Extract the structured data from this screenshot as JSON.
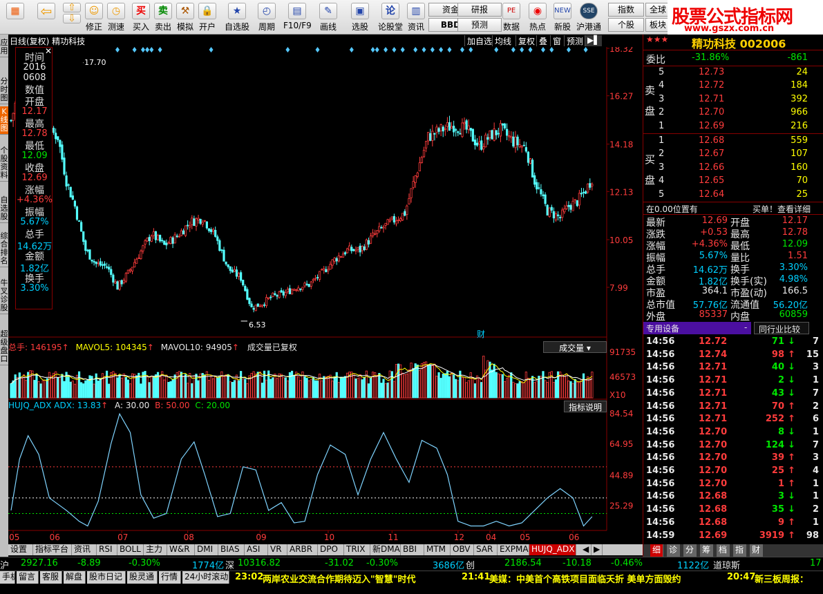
{
  "toolbar": {
    "buttons": [
      "买入",
      "卖出",
      "模拟",
      "开户",
      "自选股",
      "周期",
      "F10/F9",
      "画线",
      "选股",
      "论股堂",
      "资讯",
      "数据",
      "热点",
      "新股",
      "沪港通"
    ],
    "left_buttons": [
      "修正",
      "测速"
    ],
    "small": [
      "资金",
      "BBD",
      "研报",
      "预测",
      "指数",
      "个股",
      "全球",
      "板块"
    ]
  },
  "brand": {
    "title": "股票公式指标网",
    "url": "www.gszx.com.cn"
  },
  "left_tabs": [
    "应用",
    "分时图",
    "K线图",
    "个股资料",
    "自选股",
    "综合排名",
    "牛叉诊股",
    "超级盘口"
  ],
  "chart_header": {
    "title": "日线(复权) 精功科技",
    "controls": [
      "加自选",
      "均线",
      "复权",
      "叠",
      "窗",
      "预测"
    ]
  },
  "info_panel": [
    {
      "label": "时间",
      "value": "2016",
      "color": "white"
    },
    {
      "label": "",
      "value": "0608",
      "color": "white"
    },
    {
      "label": "数值",
      "value": "",
      "color": "white"
    },
    {
      "label": "开盘",
      "value": "12.17",
      "color": "red"
    },
    {
      "label": "最高",
      "value": "12.78",
      "color": "red"
    },
    {
      "label": "最低",
      "value": "12.09",
      "color": "green"
    },
    {
      "label": "收盘",
      "value": "12.69",
      "color": "red"
    },
    {
      "label": "涨幅",
      "value": "+4.36%",
      "color": "red"
    },
    {
      "label": "振幅",
      "value": "5.67%",
      "color": "cyan"
    },
    {
      "label": "总手",
      "value": "14.62万",
      "color": "cyan"
    },
    {
      "label": "金额",
      "value": "1.82亿",
      "color": "cyan"
    },
    {
      "label": "换手",
      "value": "3.30%",
      "color": "cyan"
    }
  ],
  "price_axis": [
    "18.32",
    "16.27",
    "14.18",
    "12.13",
    "10.05",
    "7.99"
  ],
  "price_marks": {
    "high": "17.70",
    "low": "6.53",
    "cai": "财"
  },
  "volume_header": {
    "total": "总手: 146195",
    "ma5": "MAVOL5: 104345",
    "ma10": "MAVOL10: 94905",
    "note": "成交量已复权",
    "selector": "成交量"
  },
  "volume_axis": [
    "91735",
    "46573",
    "X10"
  ],
  "indicator_header": {
    "name": "HUJQ_ADX ADX: 13.83",
    "a": "A: 30.00",
    "b": "B: 50.00",
    "c": "C: 20.00",
    "help": "指标说明"
  },
  "indicator_axis": [
    "84.54",
    "64.95",
    "44.89",
    "25.29"
  ],
  "x_axis": [
    "05",
    "06",
    "07",
    "08",
    "09",
    "10",
    "11",
    "12",
    "04",
    "05",
    "06"
  ],
  "right_panel": {
    "title": "精功科技 002006",
    "weibi_label": "委比",
    "weibi_pct": "-31.86%",
    "weibi_val": "-861",
    "sell_label": "卖盘",
    "buy_label": "买盘",
    "sells": [
      {
        "n": "5",
        "price": "12.73",
        "vol": "24"
      },
      {
        "n": "4",
        "price": "12.72",
        "vol": "184"
      },
      {
        "n": "3",
        "price": "12.71",
        "vol": "392"
      },
      {
        "n": "2",
        "price": "12.70",
        "vol": "966"
      },
      {
        "n": "1",
        "price": "12.69",
        "vol": "216"
      }
    ],
    "buys": [
      {
        "n": "1",
        "price": "12.68",
        "vol": "559"
      },
      {
        "n": "2",
        "price": "12.67",
        "vol": "107"
      },
      {
        "n": "3",
        "price": "12.66",
        "vol": "160"
      },
      {
        "n": "4",
        "price": "12.65",
        "vol": "70"
      },
      {
        "n": "5",
        "price": "12.64",
        "vol": "25"
      }
    ],
    "position_note": "在0.00位置有",
    "position_link": "买单！查看详细",
    "stats": [
      {
        "l1": "最新",
        "v1": "12.69",
        "c1": "red",
        "l2": "开盘",
        "v2": "12.17",
        "c2": "red"
      },
      {
        "l1": "涨跌",
        "v1": "+0.53",
        "c1": "red",
        "l2": "最高",
        "v2": "12.78",
        "c2": "red"
      },
      {
        "l1": "涨幅",
        "v1": "+4.36%",
        "c1": "red",
        "l2": "最低",
        "v2": "12.09",
        "c2": "green"
      },
      {
        "l1": "振幅",
        "v1": "5.67%",
        "c1": "cyan",
        "l2": "量比",
        "v2": "1.51",
        "c2": "red"
      },
      {
        "l1": "总手",
        "v1": "14.62万",
        "c1": "cyan",
        "l2": "换手",
        "v2": "3.30%",
        "c2": "cyan"
      },
      {
        "l1": "金额",
        "v1": "1.82亿",
        "c1": "cyan",
        "l2": "换手(实)",
        "v2": "4.98%",
        "c2": "cyan"
      },
      {
        "l1": "市盈",
        "v1": "364.1",
        "c1": "white",
        "l2": "市盈(动)",
        "v2": "166.5",
        "c2": "white"
      },
      {
        "l1": "总市值",
        "v1": "57.76亿",
        "c1": "cyan",
        "l2": "流通值",
        "v2": "56.20亿",
        "c2": "cyan"
      },
      {
        "l1": "外盘",
        "v1": "85337",
        "c1": "red",
        "l2": "内盘",
        "v2": "60859",
        "c2": "green"
      }
    ],
    "tab_special": "专用设备",
    "tab_compare": "同行业比较",
    "ticks": [
      {
        "t": "14:56",
        "p": "12.72",
        "v": "71",
        "d": "down",
        "n": "7"
      },
      {
        "t": "14:56",
        "p": "12.74",
        "v": "98",
        "d": "up",
        "n": "15"
      },
      {
        "t": "14:56",
        "p": "12.71",
        "v": "40",
        "d": "down",
        "n": "3"
      },
      {
        "t": "14:56",
        "p": "12.71",
        "v": "2",
        "d": "down",
        "n": "1"
      },
      {
        "t": "14:56",
        "p": "12.71",
        "v": "43",
        "d": "down",
        "n": "7"
      },
      {
        "t": "14:56",
        "p": "12.71",
        "v": "70",
        "d": "up",
        "n": "2"
      },
      {
        "t": "14:56",
        "p": "12.71",
        "v": "252",
        "d": "up",
        "n": "6"
      },
      {
        "t": "14:56",
        "p": "12.70",
        "v": "8",
        "d": "down",
        "n": "1"
      },
      {
        "t": "14:56",
        "p": "12.70",
        "v": "124",
        "d": "down",
        "n": "7"
      },
      {
        "t": "14:56",
        "p": "12.70",
        "v": "39",
        "d": "up",
        "n": "3"
      },
      {
        "t": "14:56",
        "p": "12.70",
        "v": "25",
        "d": "up",
        "n": "4"
      },
      {
        "t": "14:56",
        "p": "12.70",
        "v": "1",
        "d": "up",
        "n": "1"
      },
      {
        "t": "14:56",
        "p": "12.68",
        "v": "3",
        "d": "down",
        "n": "1"
      },
      {
        "t": "14:56",
        "p": "12.68",
        "v": "35",
        "d": "down",
        "n": "2"
      },
      {
        "t": "14:56",
        "p": "12.68",
        "v": "9",
        "d": "up",
        "n": "1"
      },
      {
        "t": "14:59",
        "p": "12.69",
        "v": "3919",
        "d": "up",
        "n": "98"
      }
    ],
    "bottom_tabs": [
      "细",
      "诊",
      "分",
      "筹",
      "档",
      "指",
      "财"
    ]
  },
  "bottom_tabs": [
    "设置",
    "指标平台",
    "资讯",
    "RSI",
    "BOLL",
    "主力",
    "W&R",
    "DMI",
    "BIAS",
    "ASI",
    "VR",
    "ARBR",
    "DPO",
    "TRIX",
    "新DMA",
    "BBI",
    "MTM",
    "OBV",
    "SAR",
    "EXPMA",
    "HUJQ_ADX"
  ],
  "status1": {
    "sh_label": "沪",
    "sh_index": "2927.16",
    "sh_chg": "-8.89",
    "sh_pct": "-0.30%",
    "sh_amt": "1774亿",
    "sz_label": "深",
    "sz_index": "10316.82",
    "sz_chg": "-31.02",
    "sz_pct": "-0.30%",
    "sz_amt": "3686亿",
    "cy_label": "创",
    "cy_index": "2186.54",
    "cy_chg": "-10.18",
    "cy_pct": "-0.46%",
    "cy_amt": "1122亿",
    "dj_label": "道琼斯",
    "dj_val": "17"
  },
  "status2": {
    "buttons": [
      "手机",
      "留言",
      "客服",
      "解盘",
      "股市日记",
      "股灵通",
      "行情",
      "24小时滚动"
    ],
    "news1_time": "23:02",
    "news1": "两岸农业交流合作期待迈入\"智慧\"时代",
    "news2_time": "21:41",
    "news2": "美媒：中美首个高铁项目面临夭折 美单方面毁约",
    "news3_time": "20:47",
    "news3": "新三板周报："
  },
  "chart_data": {
    "type": "candlestick",
    "title": "日线(复权) 精功科技",
    "x_ticks": [
      "05",
      "06",
      "07",
      "08",
      "09",
      "10",
      "11",
      "12",
      "04",
      "05",
      "06"
    ],
    "y_ticks": [
      18.32,
      16.27,
      14.18,
      12.13,
      10.05,
      7.99
    ],
    "ylim": [
      5.9,
      18.32
    ],
    "marked_high": 17.7,
    "marked_low": 6.53,
    "last_close": 12.69,
    "volume_ticks": [
      91735,
      46573
    ],
    "indicator": {
      "name": "HUJQ_ADX",
      "adx_last": 13.83,
      "levels": {
        "A": 30.0,
        "B": 50.0,
        "C": 20.0
      },
      "y_ticks": [
        84.54,
        64.95,
        44.89,
        25.29
      ],
      "ylim": [
        10,
        84.54
      ],
      "keypoints": [
        [
          0,
          22
        ],
        [
          4,
          55
        ],
        [
          8,
          70
        ],
        [
          13,
          58
        ],
        [
          18,
          30
        ],
        [
          26,
          22
        ],
        [
          32,
          15
        ],
        [
          36,
          12
        ],
        [
          41,
          28
        ],
        [
          47,
          65
        ],
        [
          51,
          84
        ],
        [
          56,
          72
        ],
        [
          61,
          32
        ],
        [
          67,
          17
        ],
        [
          73,
          20
        ],
        [
          80,
          55
        ],
        [
          86,
          66
        ],
        [
          91,
          45
        ],
        [
          97,
          18
        ],
        [
          103,
          20
        ],
        [
          109,
          50
        ],
        [
          115,
          48
        ],
        [
          121,
          22
        ],
        [
          127,
          27
        ],
        [
          133,
          14
        ],
        [
          138,
          15
        ],
        [
          144,
          45
        ],
        [
          150,
          64
        ],
        [
          157,
          58
        ],
        [
          163,
          32
        ],
        [
          169,
          55
        ],
        [
          175,
          72
        ],
        [
          181,
          55
        ],
        [
          187,
          40
        ],
        [
          193,
          67
        ],
        [
          200,
          62
        ],
        [
          205,
          45
        ],
        [
          210,
          15
        ],
        [
          216,
          12
        ],
        [
          222,
          12
        ],
        [
          228,
          15
        ],
        [
          234,
          12
        ],
        [
          240,
          14
        ],
        [
          246,
          22
        ],
        [
          252,
          30
        ],
        [
          258,
          36
        ],
        [
          264,
          30
        ],
        [
          269,
          12
        ],
        [
          273,
          18
        ]
      ]
    }
  }
}
